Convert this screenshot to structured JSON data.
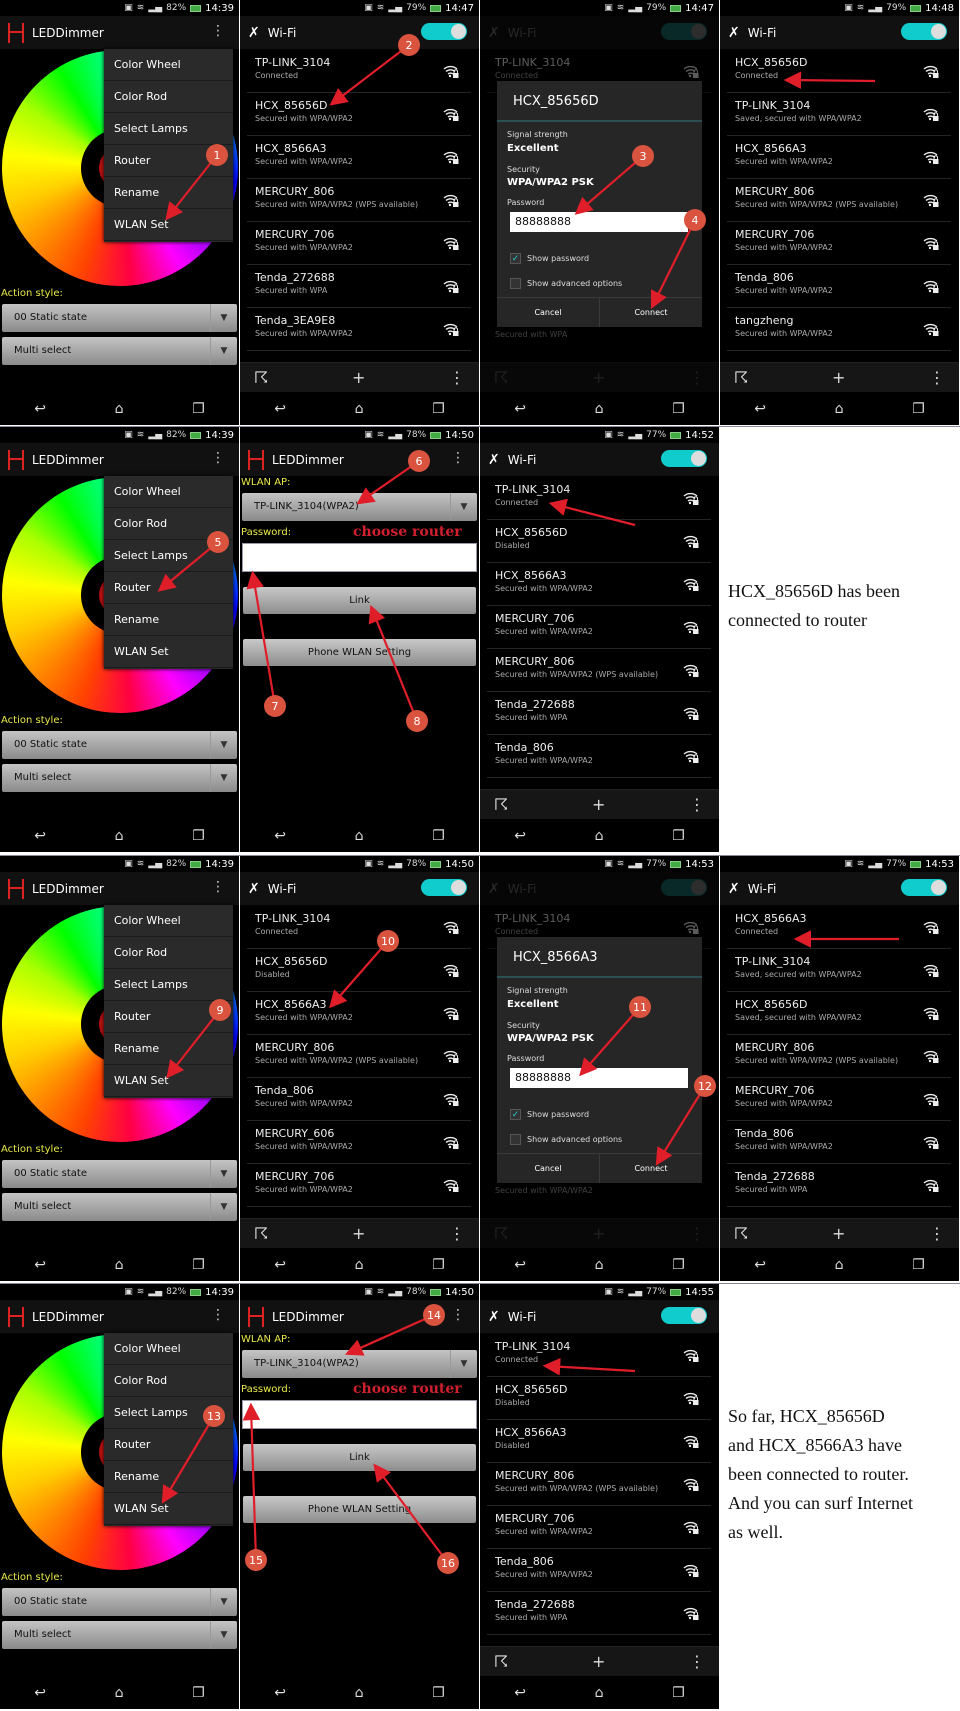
{
  "colors": {
    "annotation": "#d9533f",
    "arrow": "#e01e2a",
    "toggle": "#1cc",
    "label_yellow": "#e8e84a",
    "choose_router": "#d02030"
  },
  "icons": {
    "wifi": "wifi-lock-icon",
    "back": "back-icon",
    "home": "home-icon",
    "recents": "recents-icon",
    "overflow": "overflow-menu-icon",
    "wps": "wps-icon",
    "add": "add-icon",
    "settings": "wrench-screwdriver-icon"
  },
  "rows": [
    {
      "panels": [
        {
          "type": "leddimmer",
          "status": {
            "battery": "82%",
            "time": "14:39"
          },
          "title": "LEDDimmer",
          "menu": [
            "Color Wheel",
            "Color Rod",
            "Select Lamps",
            "Router",
            "Rename",
            "WLAN Set"
          ],
          "action_label": "Action style:",
          "dropdowns": [
            "00 Static state",
            "Multi select"
          ]
        },
        {
          "type": "wifi",
          "status": {
            "battery": "79%",
            "time": "14:47"
          },
          "title": "Wi-Fi",
          "networks": [
            {
              "name": "TP-LINK_3104",
              "sub": "Connected"
            },
            {
              "name": "HCX_85656D",
              "sub": "Secured with WPA/WPA2"
            },
            {
              "name": "HCX_8566A3",
              "sub": "Secured with WPA/WPA2"
            },
            {
              "name": "MERCURY_806",
              "sub": "Secured with WPA/WPA2 (WPS available)"
            },
            {
              "name": "MERCURY_706",
              "sub": "Secured with WPA/WPA2"
            },
            {
              "name": "Tenda_272688",
              "sub": "Secured with WPA"
            },
            {
              "name": "Tenda_3EA9E8",
              "sub": "Secured with WPA/WPA2"
            }
          ]
        },
        {
          "type": "dialog",
          "status": {
            "battery": "79%",
            "time": "14:47"
          },
          "title": "Wi-Fi",
          "networks": [
            {
              "name": "TP-LINK_3104",
              "sub": "Connected"
            }
          ],
          "bg_bottom": "Secured with WPA",
          "dialog": {
            "title": "HCX_85656D",
            "signal_label": "Signal strength",
            "signal": "Excellent",
            "security_label": "Security",
            "security": "WPA/WPA2 PSK",
            "password_label": "Password",
            "password": "88888888",
            "show_password": "Show password",
            "show_password_checked": true,
            "advanced": "Show advanced options",
            "advanced_checked": false,
            "cancel": "Cancel",
            "connect": "Connect"
          }
        },
        {
          "type": "wifi",
          "status": {
            "battery": "79%",
            "time": "14:48"
          },
          "title": "Wi-Fi",
          "networks": [
            {
              "name": "HCX_85656D",
              "sub": "Connected"
            },
            {
              "name": "TP-LINK_3104",
              "sub": "Saved, secured with WPA/WPA2"
            },
            {
              "name": "HCX_8566A3",
              "sub": "Secured with WPA/WPA2"
            },
            {
              "name": "MERCURY_806",
              "sub": "Secured with WPA/WPA2 (WPS available)"
            },
            {
              "name": "MERCURY_706",
              "sub": "Secured with WPA/WPA2"
            },
            {
              "name": "Tenda_806",
              "sub": "Secured with WPA/WPA2"
            },
            {
              "name": "tangzheng",
              "sub": "Secured with WPA/WPA2"
            }
          ]
        }
      ]
    },
    {
      "panels": [
        {
          "type": "leddimmer",
          "status": {
            "battery": "82%",
            "time": "14:39"
          },
          "title": "LEDDimmer",
          "menu": [
            "Color Wheel",
            "Color Rod",
            "Select Lamps",
            "Router",
            "Rename",
            "WLAN Set"
          ],
          "action_label": "Action style:",
          "dropdowns": [
            "00 Static state",
            "Multi select"
          ]
        },
        {
          "type": "wlanset",
          "status": {
            "battery": "78%",
            "time": "14:50"
          },
          "title": "LEDDimmer",
          "ap_label": "WLAN AP:",
          "ap_value": "TP-LINK_3104(WPA2)",
          "password_label": "Password:",
          "note": "choose router",
          "password": "",
          "link": "Link",
          "phone_setting": "Phone WLAN Setting"
        },
        {
          "type": "wifi",
          "status": {
            "battery": "77%",
            "time": "14:52"
          },
          "title": "Wi-Fi",
          "networks": [
            {
              "name": "TP-LINK_3104",
              "sub": "Connected"
            },
            {
              "name": "HCX_85656D",
              "sub": "Disabled"
            },
            {
              "name": "HCX_8566A3",
              "sub": "Secured with WPA/WPA2"
            },
            {
              "name": "MERCURY_706",
              "sub": "Secured with WPA/WPA2"
            },
            {
              "name": "MERCURY_806",
              "sub": "Secured with WPA/WPA2 (WPS available)"
            },
            {
              "name": "Tenda_272688",
              "sub": "Secured with WPA"
            },
            {
              "name": "Tenda_806",
              "sub": "Secured with WPA/WPA2"
            }
          ]
        },
        {
          "type": "text",
          "lines": [
            "HCX_85656D has been",
            "connected to router"
          ]
        }
      ]
    },
    {
      "panels": [
        {
          "type": "leddimmer",
          "status": {
            "battery": "82%",
            "time": "14:39"
          },
          "title": "LEDDimmer",
          "menu": [
            "Color Wheel",
            "Color Rod",
            "Select Lamps",
            "Router",
            "Rename",
            "WLAN Set"
          ],
          "action_label": "Action style:",
          "dropdowns": [
            "00 Static state",
            "Multi select"
          ]
        },
        {
          "type": "wifi",
          "status": {
            "battery": "78%",
            "time": "14:50"
          },
          "title": "Wi-Fi",
          "networks": [
            {
              "name": "TP-LINK_3104",
              "sub": "Connected"
            },
            {
              "name": "HCX_85656D",
              "sub": "Disabled"
            },
            {
              "name": "HCX_8566A3",
              "sub": "Secured with WPA/WPA2"
            },
            {
              "name": "MERCURY_806",
              "sub": "Secured with WPA/WPA2 (WPS available)"
            },
            {
              "name": "Tenda_806",
              "sub": "Secured with WPA/WPA2"
            },
            {
              "name": "MERCURY_606",
              "sub": "Secured with WPA/WPA2"
            },
            {
              "name": "MERCURY_706",
              "sub": "Secured with WPA/WPA2"
            }
          ]
        },
        {
          "type": "dialog",
          "status": {
            "battery": "77%",
            "time": "14:53"
          },
          "title": "Wi-Fi",
          "networks": [
            {
              "name": "TP-LINK_3104",
              "sub": "Connected"
            }
          ],
          "bg_bottom": "Secured with WPA/WPA2",
          "dialog": {
            "title": "HCX_8566A3",
            "signal_label": "Signal strength",
            "signal": "Excellent",
            "security_label": "Security",
            "security": "WPA/WPA2 PSK",
            "password_label": "Password",
            "password": "88888888",
            "show_password": "Show password",
            "show_password_checked": true,
            "advanced": "Show advanced options",
            "advanced_checked": false,
            "cancel": "Cancel",
            "connect": "Connect"
          }
        },
        {
          "type": "wifi",
          "status": {
            "battery": "77%",
            "time": "14:53"
          },
          "title": "Wi-Fi",
          "networks": [
            {
              "name": "HCX_8566A3",
              "sub": "Connected"
            },
            {
              "name": "TP-LINK_3104",
              "sub": "Saved, secured with WPA/WPA2"
            },
            {
              "name": "HCX_85656D",
              "sub": "Saved, secured with WPA/WPA2"
            },
            {
              "name": "MERCURY_806",
              "sub": "Secured with WPA/WPA2 (WPS available)"
            },
            {
              "name": "MERCURY_706",
              "sub": "Secured with WPA/WPA2"
            },
            {
              "name": "Tenda_806",
              "sub": "Secured with WPA/WPA2"
            },
            {
              "name": "Tenda_272688",
              "sub": "Secured with WPA"
            }
          ]
        }
      ]
    },
    {
      "panels": [
        {
          "type": "leddimmer",
          "status": {
            "battery": "82%",
            "time": "14:39"
          },
          "title": "LEDDimmer",
          "menu": [
            "Color Wheel",
            "Color Rod",
            "Select Lamps",
            "Router",
            "Rename",
            "WLAN Set"
          ],
          "action_label": "Action style:",
          "dropdowns": [
            "00 Static state",
            "Multi select"
          ]
        },
        {
          "type": "wlanset",
          "status": {
            "battery": "78%",
            "time": "14:50"
          },
          "title": "LEDDimmer",
          "ap_label": "WLAN AP:",
          "ap_value": "TP-LINK_3104(WPA2)",
          "password_label": "Password:",
          "note": "choose router",
          "password": "",
          "link": "Link",
          "phone_setting": "Phone WLAN Setting"
        },
        {
          "type": "wifi",
          "status": {
            "battery": "77%",
            "time": "14:55"
          },
          "title": "Wi-Fi",
          "networks": [
            {
              "name": "TP-LINK_3104",
              "sub": "Connected"
            },
            {
              "name": "HCX_85656D",
              "sub": "Disabled"
            },
            {
              "name": "HCX_8566A3",
              "sub": "Disabled"
            },
            {
              "name": "MERCURY_806",
              "sub": "Secured with WPA/WPA2 (WPS available)"
            },
            {
              "name": "MERCURY_706",
              "sub": "Secured with WPA/WPA2"
            },
            {
              "name": "Tenda_806",
              "sub": "Secured with WPA/WPA2"
            },
            {
              "name": "Tenda_272688",
              "sub": "Secured with WPA"
            }
          ]
        },
        {
          "type": "text",
          "lines": [
            "So far, HCX_85656D",
            "and HCX_8566A3 have",
            "been connected to router.",
            "And you can surf Internet",
            "as well."
          ]
        }
      ]
    }
  ],
  "annotations": [
    "1",
    "2",
    "3",
    "4",
    "5",
    "6",
    "7",
    "8",
    "9",
    "10",
    "11",
    "12",
    "13",
    "14",
    "15",
    "16"
  ]
}
